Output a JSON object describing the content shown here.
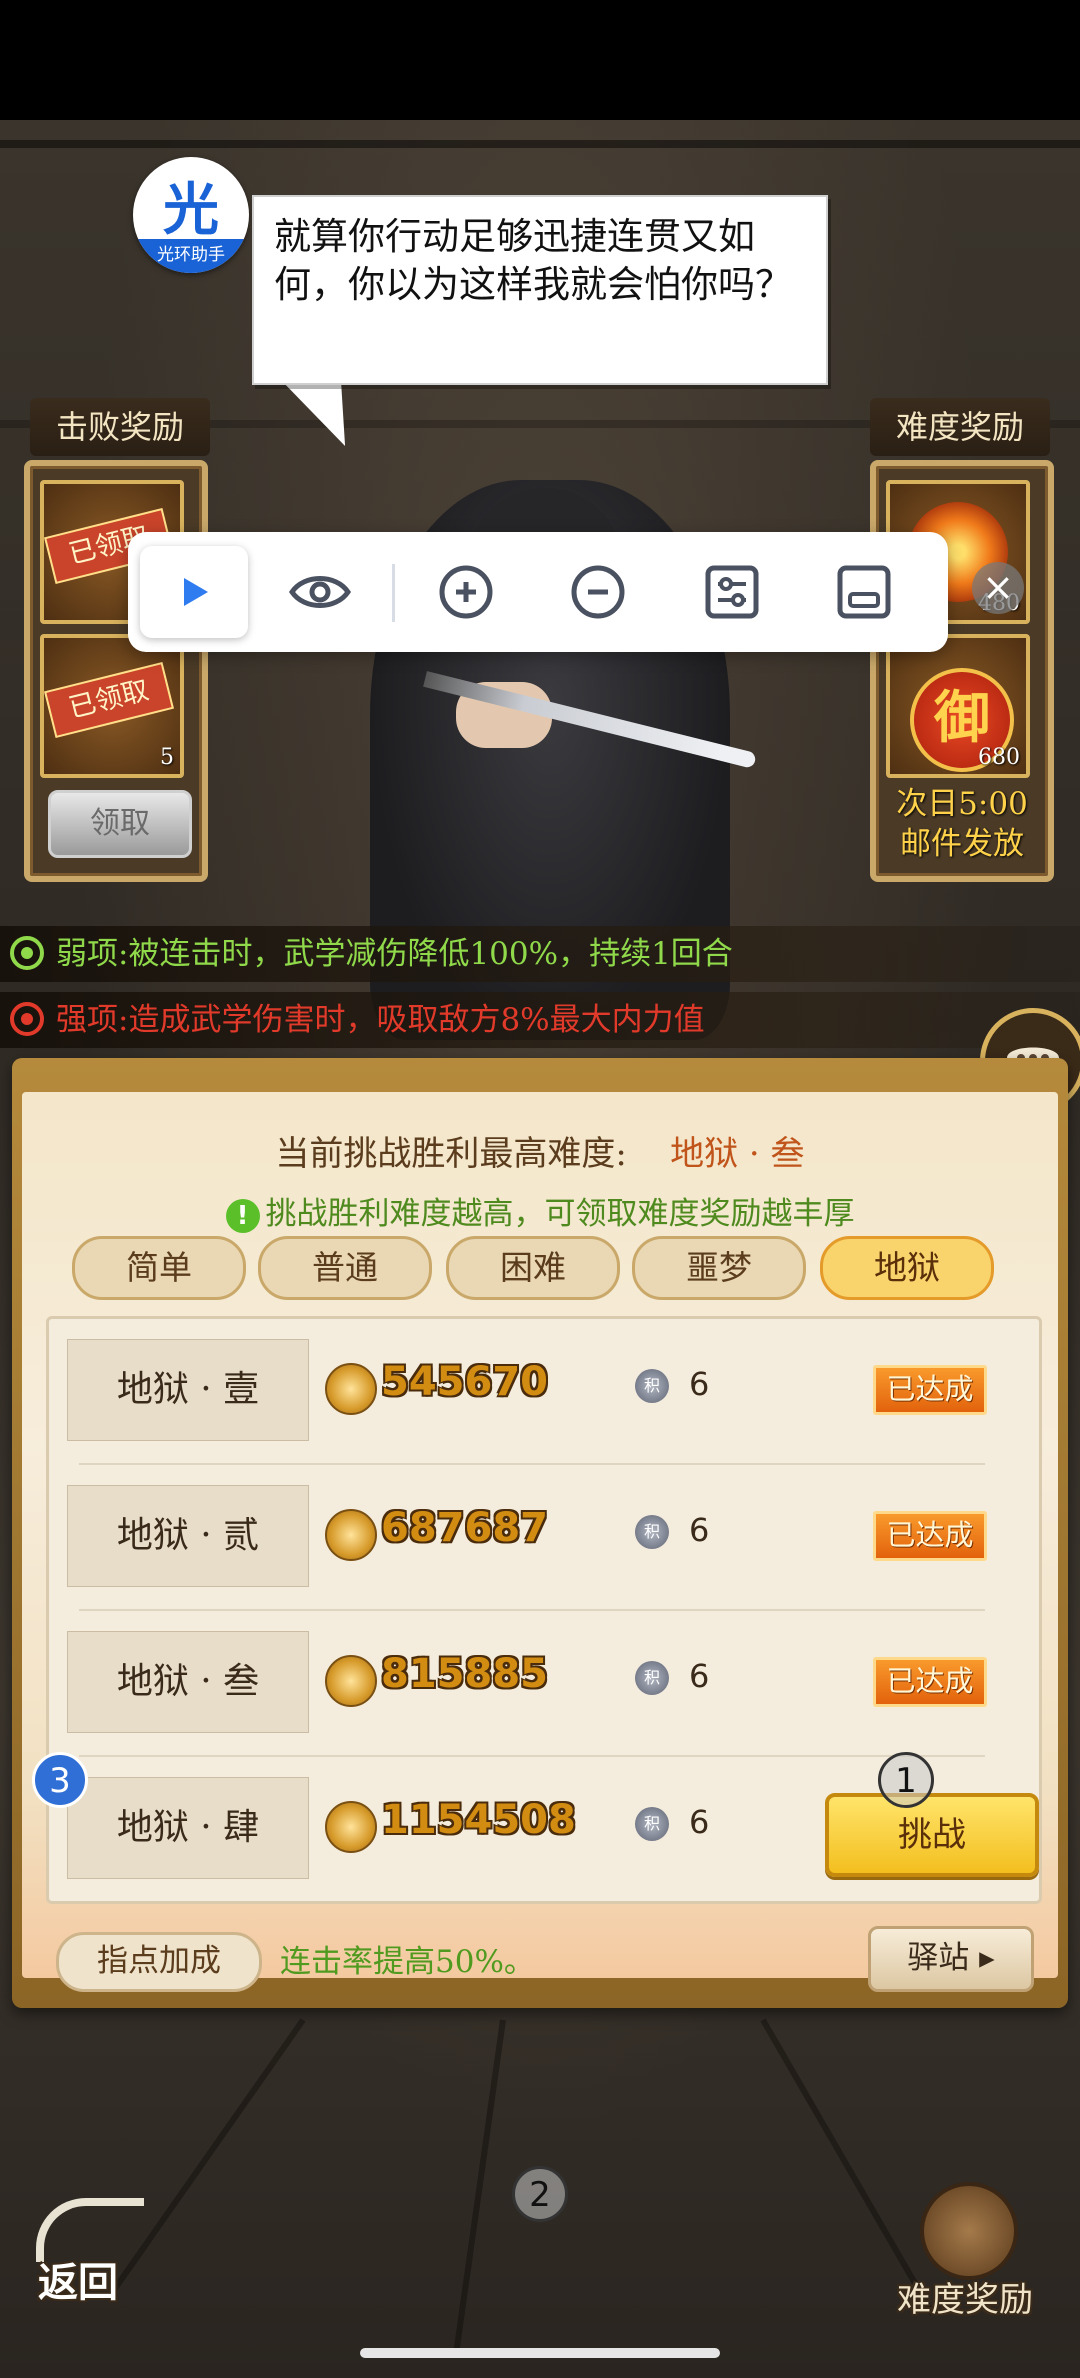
{
  "helper": {
    "logo_char": "光",
    "logo_name": "光环助手"
  },
  "dialog": {
    "text": "就算你行动足够迅捷连贯又如何，你以为这样我就会怕你吗？"
  },
  "defeat_reward": {
    "title": "击败奖励",
    "slots": [
      {
        "stamp": "已领取",
        "count": ""
      },
      {
        "stamp": "已领取",
        "count": "5"
      }
    ],
    "claim_label": "领取"
  },
  "difficulty_reward": {
    "title": "难度奖励",
    "slots": [
      {
        "icon": "flame-flower-icon",
        "count": "480"
      },
      {
        "icon": "yu-icon",
        "icon_char": "御",
        "count": "680"
      }
    ],
    "note_line1": "次日5:00",
    "note_line2": "邮件发放"
  },
  "toolbar": {
    "items": [
      "play-icon",
      "eye-icon",
      "zoom-in-icon",
      "zoom-out-icon",
      "settings-sliders-icon",
      "window-icon"
    ],
    "close": "×"
  },
  "buffs": {
    "weak": {
      "text": "弱项:被连击时，武学减伤降低100%，持续1回合",
      "color": "#8fd94a"
    },
    "strong": {
      "text": "强项:造成武学伤害时，吸取敌方8%最大内力值",
      "color": "#e23a2a"
    }
  },
  "panel": {
    "header_label": "当前挑战胜利最高难度:",
    "header_value": "地狱 · 叁",
    "hint_icon": "!",
    "hint": "挑战胜利难度越高，可领取难度奖励越丰厚",
    "tabs": [
      "简单",
      "普通",
      "困难",
      "噩梦",
      "地狱"
    ],
    "active_tab": "地狱",
    "rows": [
      {
        "name": "地狱 · 壹",
        "score": "545670",
        "points": "6",
        "status": "已达成"
      },
      {
        "name": "地狱 · 贰",
        "score": "687687",
        "points": "6",
        "status": "已达成"
      },
      {
        "name": "地狱 · 叁",
        "score": "815885",
        "points": "6",
        "status": "已达成"
      },
      {
        "name": "地狱 · 肆",
        "score": "1154508",
        "points": "6",
        "status": "挑战"
      }
    ],
    "point_icon_char": "积",
    "bonus_label": "指点加成",
    "bonus_text": "连击率提高50%。",
    "station_label": "驿站"
  },
  "markers": {
    "m1": "1",
    "m2": "2",
    "m3": "3"
  },
  "bottom": {
    "back_label": "返回",
    "difficulty_reward_label": "难度奖励"
  }
}
